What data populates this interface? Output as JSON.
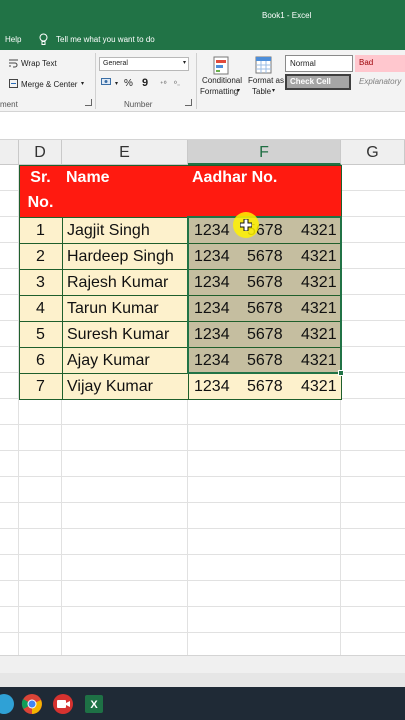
{
  "window": {
    "title": "Book1  -  Excel"
  },
  "tellbar": {
    "help_label": "Help",
    "tell_me": "Tell me what you want to do"
  },
  "ribbon": {
    "wrap_text": "Wrap Text",
    "merge_center": "Merge & Center",
    "alignment_group": "ment",
    "number_format": "General",
    "currency_symbol": "%",
    "comma_symbol": "9",
    "number_group": "Number",
    "conditional_formatting": [
      "Conditional",
      "Formatting"
    ],
    "format_as_table": [
      "Format as",
      "Table"
    ],
    "style_normal": "Normal",
    "style_bad": "Bad",
    "style_check_cell": "Check Cell",
    "style_explanatory": "Explanatory"
  },
  "columns": [
    "D",
    "E",
    "F",
    "G"
  ],
  "table": {
    "headers": {
      "sr_line1": "Sr.",
      "sr_line2": "No.",
      "name": "Name",
      "aadhar": "Aadhar No."
    },
    "rows": [
      {
        "sr": "1",
        "name": "Jagjit Singh",
        "aadhar": [
          "1234",
          "5678",
          "4321"
        ]
      },
      {
        "sr": "2",
        "name": "Hardeep Singh",
        "aadhar": [
          "1234",
          "5678",
          "4321"
        ]
      },
      {
        "sr": "3",
        "name": "Rajesh Kumar",
        "aadhar": [
          "1234",
          "5678",
          "4321"
        ]
      },
      {
        "sr": "4",
        "name": "Tarun Kumar",
        "aadhar": [
          "1234",
          "5678",
          "4321"
        ]
      },
      {
        "sr": "5",
        "name": "Suresh Kumar",
        "aadhar": [
          "1234",
          "5678",
          "4321"
        ]
      },
      {
        "sr": "6",
        "name": "Ajay Kumar",
        "aadhar": [
          "1234",
          "5678",
          "4321"
        ]
      },
      {
        "sr": "7",
        "name": "Vijay Kumar",
        "aadhar": [
          "1234",
          "5678",
          "4321"
        ]
      }
    ]
  },
  "colors": {
    "excel_green": "#217346",
    "header_red": "#ff1a10",
    "row_fill": "#fdf1cc",
    "selected_fill": "#c5bea0"
  },
  "taskbar_icons": [
    "chrome-icon",
    "video-icon",
    "excel-icon"
  ]
}
